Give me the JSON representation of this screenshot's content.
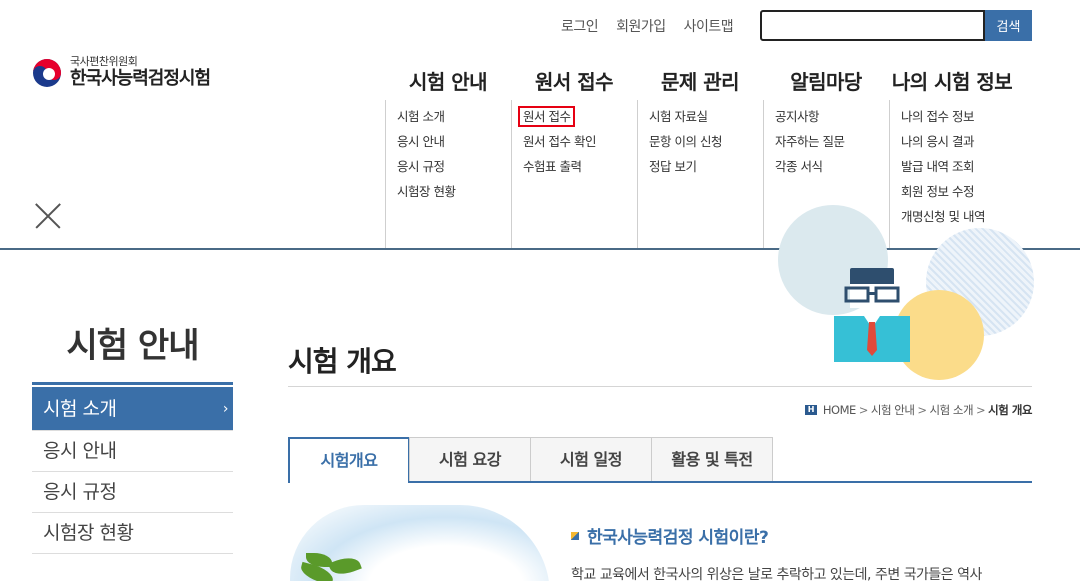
{
  "utility": {
    "login": "로그인",
    "join": "회원가입",
    "sitemap": "사이트맵"
  },
  "search": {
    "value": "",
    "placeholder": "",
    "button": "검색"
  },
  "logo": {
    "sub": "국사편찬위원회",
    "main": "한국사능력검정시험"
  },
  "gnb": [
    {
      "title": "시험 안내",
      "items": [
        "시험 소개",
        "응시 안내",
        "응시 규정",
        "시험장 현황"
      ]
    },
    {
      "title": "원서 접수",
      "items": [
        "원서 접수",
        "원서 접수 확인",
        "수험표 출력"
      ]
    },
    {
      "title": "문제 관리",
      "items": [
        "시험 자료실",
        "문항 이의 신청",
        "정답 보기"
      ]
    },
    {
      "title": "알림마당",
      "items": [
        "공지사항",
        "자주하는 질문",
        "각종 서식"
      ]
    },
    {
      "title": "나의 시험 정보",
      "items": [
        "나의 접수 정보",
        "나의 응시 결과",
        "발급 내역 조회",
        "회원 정보 수정",
        "개명신청 및 내역"
      ]
    }
  ],
  "highlighted_item": "원서 접수",
  "lnb": {
    "title": "시험 안내",
    "items": [
      "시험 소개",
      "응시 안내",
      "응시 규정",
      "시험장 현황"
    ],
    "active_index": 0,
    "arrow": "›"
  },
  "page": {
    "title": "시험 개요"
  },
  "breadcrumb": {
    "home_badge": "H",
    "items": [
      "HOME",
      "시험 안내",
      "시험 소개"
    ],
    "current": "시험 개요",
    "separator": ">"
  },
  "tabs": [
    "시험개요",
    "시험 요강",
    "시험 일정",
    "활용 및 특전"
  ],
  "active_tab": 0,
  "section": {
    "title": "한국사능력검정 시험이란?",
    "text": "학교 교육에서 한국사의 위상은 날로 추락하고 있는데, 주변 국가들은 역사"
  },
  "colors": {
    "accent": "#3a6fa8",
    "highlight_border": "#e60012",
    "divider": "#4a6a86"
  }
}
